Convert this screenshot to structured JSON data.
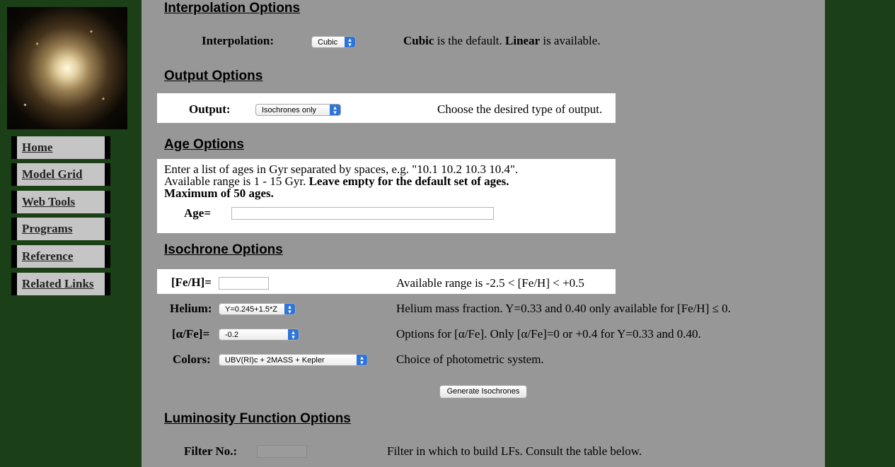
{
  "sidebar": {
    "image_alt": "globular star cluster",
    "nav": [
      "Home",
      "Model Grid",
      "Web Tools",
      "Programs",
      "Reference",
      "Related Links"
    ]
  },
  "interpolation": {
    "heading": "Interpolation Options",
    "label": "Interpolation:",
    "value": "Cubic",
    "desc_b1": "Cubic",
    "desc_t1": " is the default. ",
    "desc_b2": "Linear",
    "desc_t2": " is available."
  },
  "output": {
    "heading": "Output Options",
    "label": "Output:",
    "value": "Isochrones only",
    "desc": "Choose the desired type of output."
  },
  "age": {
    "heading": "Age Options",
    "line1": "Enter a list of ages in Gyr separated by spaces, e.g. \"10.1 10.2 10.3 10.4\".",
    "line2a": "Available range is 1 - 15 Gyr. ",
    "line2b": "Leave empty for the default set of ages.",
    "line3": "Maximum of 50 ages.",
    "label": "Age=",
    "value": ""
  },
  "isochrone": {
    "heading": "Isochrone Options",
    "feh_label": "[Fe/H]=",
    "feh_value": "",
    "feh_desc": "Available range is -2.5 < [Fe/H] < +0.5",
    "helium_label": "Helium:",
    "helium_value": "Y=0.245+1.5*Z",
    "helium_desc": "Helium mass fraction. Y=0.33 and 0.40 only available for [Fe/H] ≤ 0.",
    "alpha_label": "[α/Fe]=",
    "alpha_value": "-0.2",
    "alpha_desc": "Options for [α/Fe]. Only [α/Fe]=0 or +0.4 for Y=0.33 and 0.40.",
    "colors_label": "Colors:",
    "colors_value": "UBV(RI)c + 2MASS + Kepler",
    "colors_desc": "Choice of photometric system.",
    "generate_button": "Generate Isochrones"
  },
  "lf": {
    "heading": "Luminosity Function Options",
    "filter_label": "Filter No.:",
    "filter_value": "",
    "filter_desc": "Filter in which to build LFs. Consult the table below."
  },
  "colors": {
    "page_bg": "#1b3f16",
    "panel_bg": "#979797",
    "select_arrow": "#2f74d9"
  }
}
